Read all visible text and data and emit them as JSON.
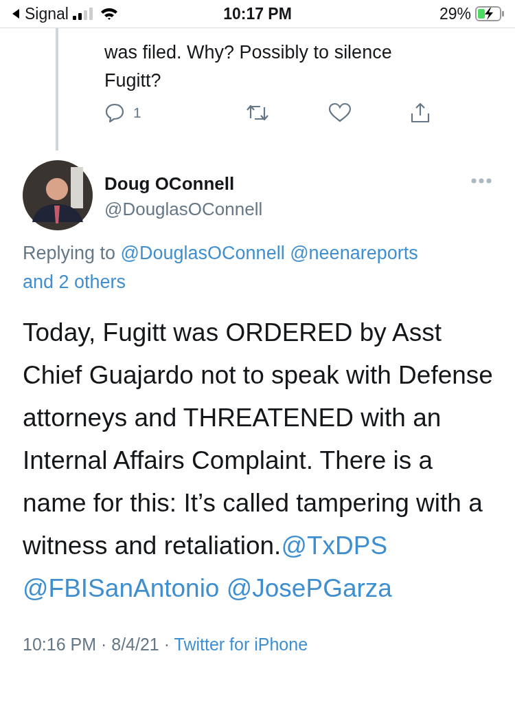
{
  "status_bar": {
    "back_app": "Signal",
    "time": "10:17 PM",
    "battery": "29%"
  },
  "previous_tweet": {
    "text": "was filed. Why? Possibly to silence Fugitt?",
    "reply_count": "1"
  },
  "tweet": {
    "name": "Doug OConnell",
    "handle": "@DouglasOConnell",
    "replying_to": {
      "prefix": "Replying to",
      "links": [
        "@DouglasOConnell",
        "@neenareports",
        "and 2 others"
      ]
    },
    "body": {
      "text": "Today, Fugitt was ORDERED by Asst Chief Guajardo not to speak with Defense attorneys and THREATENED with an Internal Affairs Complaint. There is a name for this: It’s called tampering with a witness and retaliation.",
      "mentions": [
        "@TxDPS",
        "@FBISanAntonio",
        "@JosePGarza"
      ]
    },
    "timestamp": {
      "text": "10:16 PM · 8/4/21 ·",
      "source": "Twitter for iPhone"
    }
  }
}
